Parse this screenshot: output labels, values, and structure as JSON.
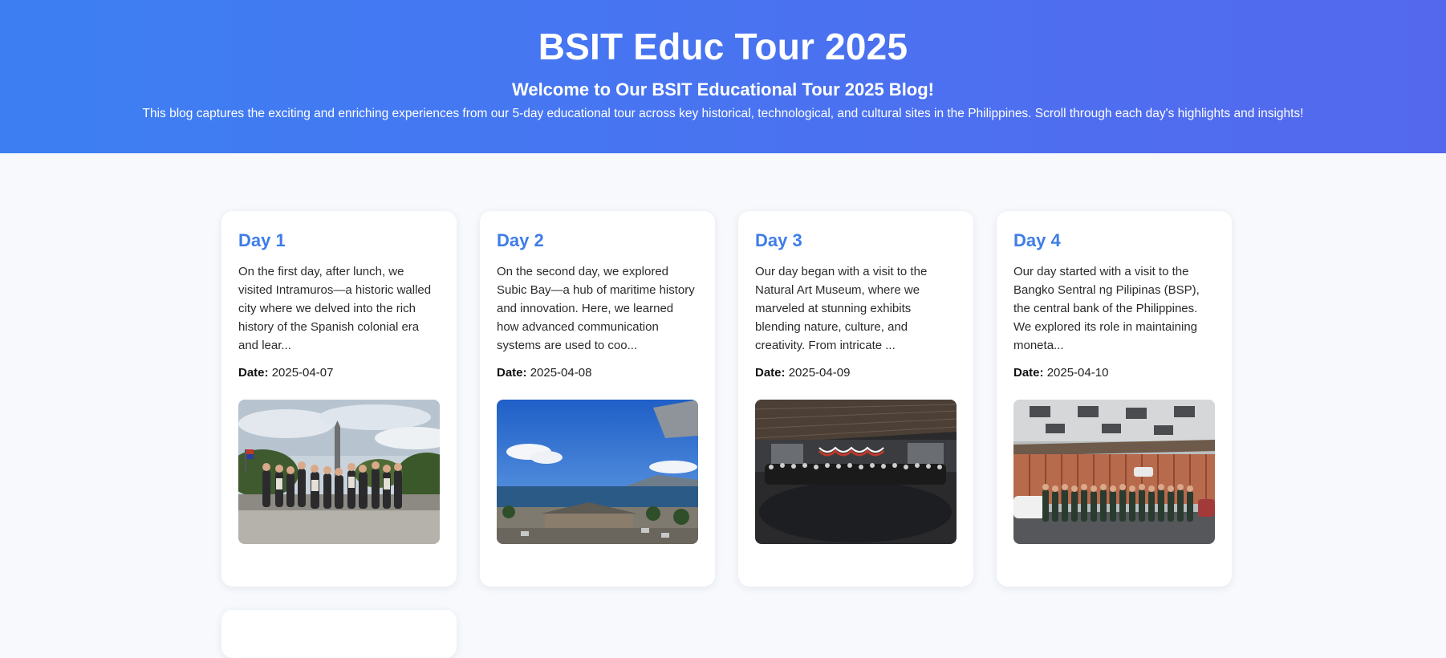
{
  "header": {
    "title": "BSIT Educ Tour 2025",
    "subtitle": "Welcome to Our BSIT Educational Tour 2025 Blog!",
    "intro": "This blog captures the exciting and enriching experiences from our 5-day educational tour across key historical, technological, and cultural sites in the Philippines. Scroll through each day's highlights and insights!"
  },
  "posts": [
    {
      "title": "Day 1",
      "excerpt": "On the first day, after lunch, we visited Intramuros—a historic walled city where we delved into the rich history of the Spanish colonial era and lear...",
      "date_label": "Date:",
      "date": "2025-04-07",
      "photo": "group photo at a monument park"
    },
    {
      "title": "Day 2",
      "excerpt": "On the second day, we explored Subic Bay—a hub of maritime history and innovation. Here, we learned how advanced communication systems are used to coo...",
      "date_label": "Date:",
      "date": "2025-04-08",
      "photo": "view of Subic Bay"
    },
    {
      "title": "Day 3",
      "excerpt": "Our day began with a visit to the Natural Art Museum, where we marveled at stunning exhibits blending nature, culture, and creativity. From intricate ...",
      "date_label": "Date:",
      "date": "2025-04-09",
      "photo": "group photo inside a museum hall"
    },
    {
      "title": "Day 4",
      "excerpt": "Our day started with a visit to the Bangko Sentral ng Pilipinas (BSP), the central bank of the Philippines. We explored its role in maintaining moneta...",
      "date_label": "Date:",
      "date": "2025-04-10",
      "photo": "group photo in front of a building"
    }
  ]
}
